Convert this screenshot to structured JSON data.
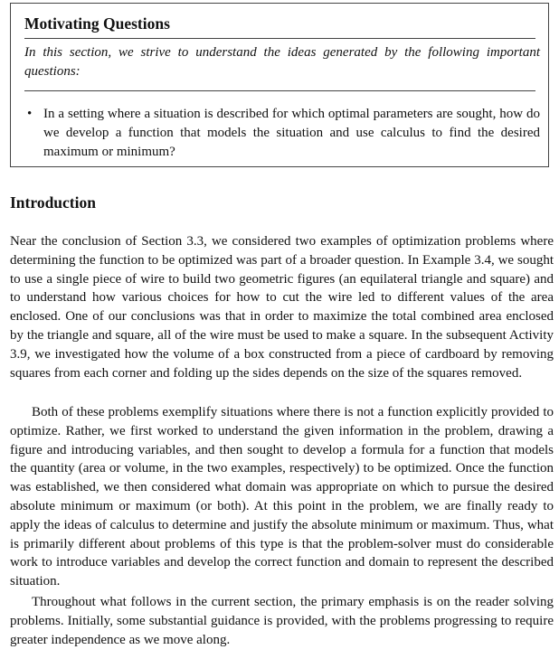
{
  "motivating": {
    "title": "Motivating Questions",
    "intro": "In this section, we strive to understand the ideas generated by the following important questions:",
    "questions": [
      "In a setting where a situation is described for which optimal parameters are sought, how do we develop a function that models the situation and use calculus to find the desired maximum or minimum?"
    ]
  },
  "introduction": {
    "heading": "Introduction",
    "paragraphs": [
      "Near the conclusion of Section 3.3, we considered two examples of optimization problems where determining the function to be optimized was part of a broader question. In Example 3.4, we sought to use a single piece of wire to build two geometric figures (an equilateral triangle and square) and to understand how various choices for how to cut the wire led to different values of the area enclosed. One of our conclusions was that in order to maximize the total combined area enclosed by the triangle and square, all of the wire must be used to make a square. In the subsequent Activity 3.9, we investigated how the volume of a box constructed from a piece of cardboard by removing squares from each corner and folding up the sides depends on the size of the squares removed.",
      "Both of these problems exemplify situations where there is not a function explicitly provided to optimize. Rather, we first worked to understand the given information in the problem, drawing a figure and introducing variables, and then sought to develop a formula for a function that models the quantity (area or volume, in the two examples, respectively) to be optimized. Once the function was established, we then considered what domain was appropriate on which to pursue the desired absolute minimum or maximum (or both). At this point in the problem, we are finally ready to apply the ideas of calculus to determine and justify the absolute minimum or maximum. Thus, what is primarily different about problems of this type is that the problem-solver must do considerable work to introduce variables and develop the correct function and domain to represent the described situation.",
      "Throughout what follows in the current section, the primary emphasis is on the reader solving problems. Initially, some substantial guidance is provided, with the problems progressing to require greater independence as we move along."
    ]
  },
  "bullet_glyph": "•"
}
